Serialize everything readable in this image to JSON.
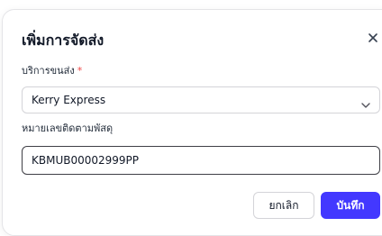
{
  "dialog": {
    "title": "เพิ่มการจัดส่ง",
    "close_icon": "close-icon"
  },
  "form": {
    "service_label": "บริการขนส่ง",
    "required_marker": "*",
    "service_value": "Kerry Express",
    "tracking_label": "หมายเลขติดตามพัสดุ",
    "tracking_value": "KBMUB00002999PP"
  },
  "actions": {
    "cancel_label": "ยกเลิก",
    "save_label": "บันทึก"
  },
  "colors": {
    "primary": "#4338ff",
    "required": "#ef4444",
    "input_border": "#3f3f46"
  }
}
